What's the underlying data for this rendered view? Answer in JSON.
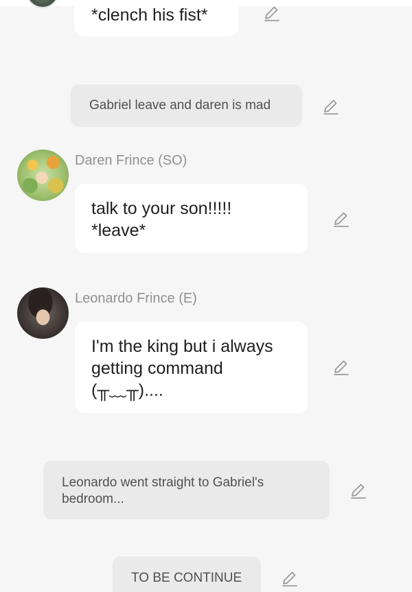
{
  "messages": {
    "m1": {
      "text": "*clench his fist*"
    },
    "n1": {
      "text": "Gabriel leave and daren is mad"
    },
    "m2": {
      "sender": "Daren Frince (SO)",
      "line1": "talk to your son!!!!!",
      "line2": "*leave*"
    },
    "m3": {
      "sender": "Leonardo Frince (E)",
      "line1": "I'm the king but i always",
      "line2": "getting command",
      "line3": "(╥﹏╥)...."
    },
    "n2": {
      "line1": "Leonardo went straight to Gabriel's",
      "line2": "bedroom..."
    },
    "n3": {
      "text": "TO BE CONTINUE"
    }
  },
  "icons": {
    "edit": "pencil-edit-icon",
    "avatar_daren": "avatar-flowers",
    "avatar_leonardo": "avatar-dark-haired-man"
  },
  "colors": {
    "background": "#f6f6f6",
    "bubble": "#ffffff",
    "narration": "#eaeaea",
    "sender_name": "#909090",
    "icon": "#9a9a9a"
  }
}
